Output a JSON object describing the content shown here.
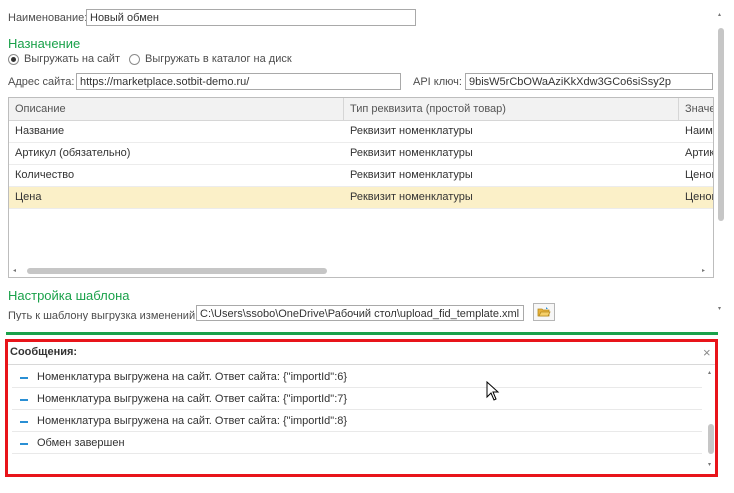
{
  "name_field": {
    "label": "Наименование:",
    "value": "Новый обмен"
  },
  "destination": {
    "title": "Назначение",
    "options": [
      "Выгружать на сайт",
      "Выгружать в каталог на диск"
    ],
    "selected_index": 0
  },
  "site": {
    "address_label": "Адрес сайта:",
    "address_value": "https://marketplace.sotbit-demo.ru/",
    "api_label": "API ключ:",
    "api_value": "9bisW5rCbOWaAziKkXdw3GCo6siSsy2p"
  },
  "table": {
    "columns": [
      "Описание",
      "Тип реквизита (простой товар)",
      "Значе"
    ],
    "rows": [
      {
        "description": "Название",
        "type": "Реквизит номенклатуры",
        "value": "Наиме"
      },
      {
        "description": "Артикул (обязательно)",
        "type": "Реквизит номенклатуры",
        "value": "Артику"
      },
      {
        "description": "Количество",
        "type": "Реквизит номенклатуры",
        "value": "Ценов"
      },
      {
        "description": "Цена",
        "type": "Реквизит номенклатуры",
        "value": "Ценов"
      }
    ],
    "selected_row_index": 3
  },
  "template": {
    "title": "Настройка шаблона",
    "path_label": "Путь к шаблону выгрузка изменений:",
    "path_value": "C:\\Users\\ssobo\\OneDrive\\Рабочий стол\\upload_fid_template.xml"
  },
  "messages": {
    "title": "Сообщения:",
    "close": "×",
    "items": [
      "Номенклатура выгружена на сайт. Ответ сайта: {\"importId\":6}",
      "Номенклатура выгружена на сайт. Ответ сайта: {\"importId\":7}",
      "Номенклатура выгружена на сайт. Ответ сайта: {\"importId\":8}",
      "Обмен завершен"
    ]
  },
  "colors": {
    "section_green": "#1aa14a",
    "selected_row": "#fbf0c8",
    "highlight_red": "#e8141a",
    "message_dash": "#2a8fd4"
  },
  "icons": [
    "radio-icon",
    "folder-open-icon",
    "close-icon",
    "mouse-cursor-icon"
  ]
}
